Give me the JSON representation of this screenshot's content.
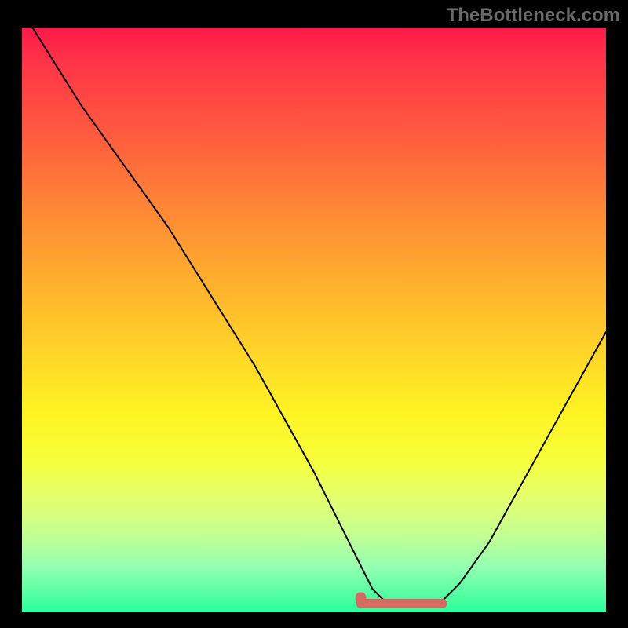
{
  "attribution": "TheBottleneck.com",
  "chart_data": {
    "type": "line",
    "title": "",
    "xlabel": "",
    "ylabel": "",
    "xlim": [
      0,
      100
    ],
    "ylim": [
      0,
      100
    ],
    "series": [
      {
        "name": "curve",
        "x": [
          0,
          5,
          10,
          15,
          20,
          25,
          30,
          35,
          40,
          45,
          50,
          55,
          58,
          60,
          62,
          65,
          70,
          72,
          75,
          80,
          85,
          90,
          95,
          100
        ],
        "y": [
          103,
          95,
          87,
          80,
          73,
          66,
          58,
          50,
          42,
          33,
          24,
          14,
          8,
          4,
          2,
          1,
          1,
          2,
          5,
          12,
          21,
          30,
          39,
          48
        ]
      }
    ],
    "marker_zone": {
      "x_start": 58,
      "x_end": 72,
      "y": 1.5
    },
    "marker_dot": {
      "x": 58,
      "y": 2.5
    },
    "optimal_band": {
      "y_start": 0,
      "y_end": 3
    },
    "colors": {
      "curve": "#000000",
      "marker": "#d66a63",
      "top": "#ff1a4a",
      "bottom": "#2bff9a"
    }
  }
}
